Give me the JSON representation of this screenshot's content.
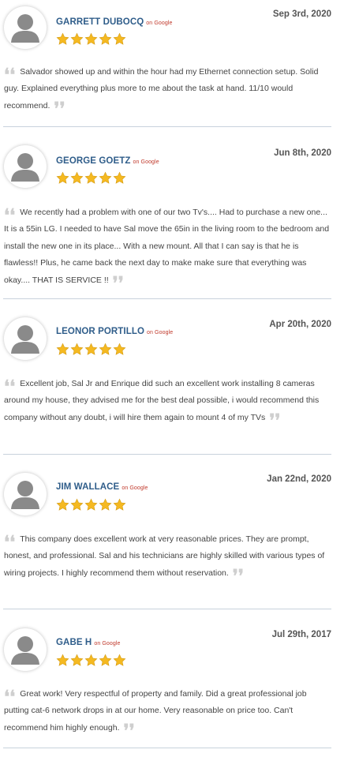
{
  "reviews": [
    {
      "name": "GARRETT DUBOCQ",
      "source": "on Google",
      "date": "Sep 3rd, 2020",
      "rating": 5,
      "text": "Salvador showed up and within the hour had my Ethernet connection setup. Solid guy. Explained everything plus more to me about the task at hand. 11/10 would recommend."
    },
    {
      "name": "GEORGE GOETZ",
      "source": "on Google",
      "date": "Jun 8th, 2020",
      "rating": 5,
      "text": "We recently had a problem with one of our two Tv's.... Had to purchase a new one... It is a 55in LG. I needed to have Sal move the 65in in the living room to the bedroom and install the new one in its place... With a new mount. All that I can say is that he is flawless!! Plus, he came back the next day to make make sure that everything was okay.... THAT IS SERVICE !!"
    },
    {
      "name": "LEONOR PORTILLO",
      "source": "on Google",
      "date": "Apr 20th, 2020",
      "rating": 5,
      "text": "Excellent job, Sal Jr and Enrique did such an excellent work installing 8 cameras around my house, they advised me for the best deal possible, i would recommend this company without any doubt, i will hire them again to mount 4 of my TVs"
    },
    {
      "name": "JIM WALLACE",
      "source": "on Google",
      "date": "Jan 22nd, 2020",
      "rating": 5,
      "text": "This company does excellent work at very reasonable prices. They are prompt, honest, and professional. Sal and his technicians are highly skilled with various types of wiring projects. I highly recommend them without reservation."
    },
    {
      "name": "GABE H",
      "source": "on Google",
      "date": "Jul 29th, 2017",
      "rating": 5,
      "text": "Great work! Very respectful of property and family. Did a great professional job putting cat-6 network drops in at our home. Very reasonable on price too. Can't recommend him highly enough."
    }
  ],
  "colors": {
    "name": "#2f5d8a",
    "source": "#c0392b",
    "star": "#f5b921",
    "divider": "#c8d2dc"
  },
  "icons": {
    "avatar": "default-user-avatar-icon",
    "star": "star-icon",
    "quote_open": "open-quote-icon",
    "quote_close": "close-quote-icon"
  }
}
